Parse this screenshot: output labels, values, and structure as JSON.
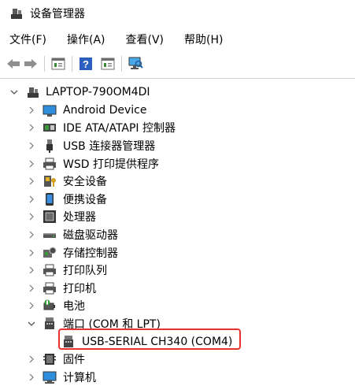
{
  "window": {
    "title": "设备管理器",
    "icon": "device-manager-icon"
  },
  "menu": [
    "文件(F)",
    "操作(A)",
    "查看(V)",
    "帮助(H)"
  ],
  "toolbar": [
    "back-arrow-icon",
    "forward-arrow-icon",
    "properties-icon",
    "help-icon",
    "update-driver-icon",
    "scan-hardware-icon"
  ],
  "tree": {
    "root": "LAPTOP-790OM4DI",
    "items": [
      {
        "label": "Android Device",
        "icon": "android-device-icon",
        "expanded": false
      },
      {
        "label": "IDE ATA/ATAPI 控制器",
        "icon": "ide-controller-icon",
        "expanded": false
      },
      {
        "label": "USB 连接器管理器",
        "icon": "usb-connector-icon",
        "expanded": false
      },
      {
        "label": "WSD 打印提供程序",
        "icon": "wsd-printer-icon",
        "expanded": false
      },
      {
        "label": "安全设备",
        "icon": "security-device-icon",
        "expanded": false
      },
      {
        "label": "便携设备",
        "icon": "portable-device-icon",
        "expanded": false
      },
      {
        "label": "处理器",
        "icon": "processor-icon",
        "expanded": false
      },
      {
        "label": "磁盘驱动器",
        "icon": "disk-drive-icon",
        "expanded": false
      },
      {
        "label": "存储控制器",
        "icon": "storage-controller-icon",
        "expanded": false
      },
      {
        "label": "打印队列",
        "icon": "print-queue-icon",
        "expanded": false
      },
      {
        "label": "打印机",
        "icon": "printer-icon",
        "expanded": false
      },
      {
        "label": "电池",
        "icon": "battery-icon",
        "expanded": false
      },
      {
        "label": "端口 (COM 和 LPT)",
        "icon": "port-icon",
        "expanded": true,
        "children": [
          {
            "label": "USB-SERIAL CH340 (COM4)",
            "icon": "serial-port-icon",
            "highlighted": true
          }
        ]
      },
      {
        "label": "固件",
        "icon": "firmware-icon",
        "expanded": false
      },
      {
        "label": "计算机",
        "icon": "computer-icon",
        "expanded": false
      }
    ]
  },
  "colors": {
    "highlight_border": "#e8322f",
    "accent": "#2b6cb0"
  }
}
